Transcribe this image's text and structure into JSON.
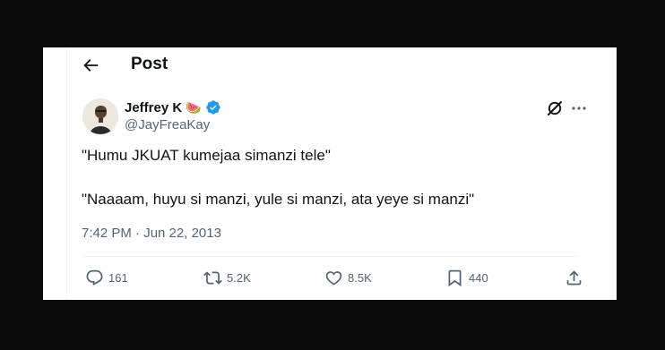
{
  "header": {
    "title": "Post"
  },
  "author": {
    "name": "Jeffrey K",
    "emoji": "🍉",
    "handle": "@JayFreaKay"
  },
  "tweet": {
    "lines": [
      "\"Humu JKUAT kumejaa simanzi tele\"",
      "\"Naaaam, huyu si manzi, yule si manzi, ata yeye si manzi\""
    ],
    "timestamp": "7:42 PM · Jun 22, 2013"
  },
  "actions": {
    "replies": "161",
    "reposts": "5.2K",
    "likes": "8.5K",
    "bookmarks": "440"
  },
  "colors": {
    "text": "#0f1419",
    "muted": "#536471",
    "verified": "#1d9bf0",
    "frame": "#0b0b0b"
  },
  "icons": [
    "back-arrow-icon",
    "verified-badge-icon",
    "grok-icon",
    "more-icon",
    "reply-icon",
    "repost-icon",
    "like-icon",
    "bookmark-icon",
    "share-icon"
  ]
}
